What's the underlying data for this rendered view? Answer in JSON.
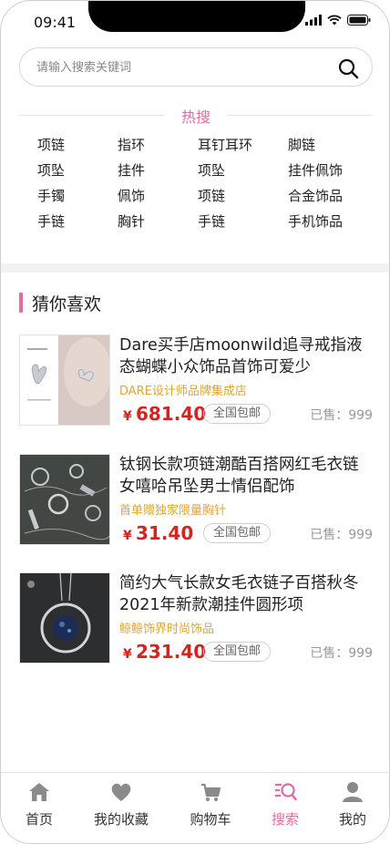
{
  "status_bar": {
    "time": "09:41"
  },
  "search": {
    "placeholder": "请输入搜索关键词"
  },
  "hot": {
    "title": "热搜",
    "items": [
      "项链",
      "指环",
      "耳钉耳环",
      "脚链",
      "项坠",
      "挂件",
      "项坠",
      "挂件佩饰",
      "手镯",
      "佩饰",
      "项链",
      "合金饰品",
      "手链",
      "胸针",
      "手链",
      "手机饰品"
    ]
  },
  "guess": {
    "title": "猜你喜欢",
    "products": [
      {
        "name": "Dare买手店moonwild追寻戒指液态蝴蝶小众饰品首饰可爱少",
        "shop": "DARE设计师品牌集成店",
        "currency": "¥",
        "price": "681.40",
        "shipping": "全国包邮",
        "sold": "已售：999"
      },
      {
        "name": "钛钢长款项链潮酷百搭网红毛衣链女嘻哈吊坠男士情侣配饰",
        "shop": "首单赠独家限量胸针",
        "currency": "¥",
        "price": "31.40",
        "shipping": "全国包邮",
        "sold": "已售：999"
      },
      {
        "name": "简约大气长款女毛衣链子百搭秋冬2021年新款潮挂件圆形项",
        "shop": "鲸鲸饰界时尚饰品",
        "currency": "¥",
        "price": "231.40",
        "shipping": "全国包邮",
        "sold": "已售：999"
      }
    ]
  },
  "tabs": [
    {
      "label": "首页",
      "icon": "home-icon"
    },
    {
      "label": "我的收藏",
      "icon": "heart-icon"
    },
    {
      "label": "购物车",
      "icon": "cart-icon"
    },
    {
      "label": "搜索",
      "icon": "search-list-icon",
      "active": true
    },
    {
      "label": "我的",
      "icon": "user-icon"
    }
  ],
  "colors": {
    "accent": "#e46aa6",
    "price": "#d3251f",
    "shop": "#e0a62e"
  }
}
